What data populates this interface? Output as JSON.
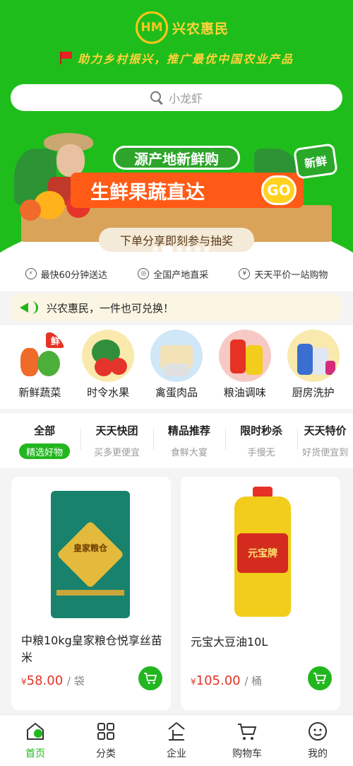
{
  "header": {
    "logo_mark": "HM",
    "logo_text": "兴农惠民",
    "slogan": "助力乡村振兴，推广最优中国农业产品"
  },
  "search": {
    "placeholder": "小龙虾"
  },
  "banner": {
    "headline": "源产地新鲜购",
    "main": "生鲜果蔬直达",
    "go": "GO",
    "sub": "下单分享即刻参与抽奖",
    "tag": "新鲜",
    "slides": 6,
    "active_slide": 2
  },
  "features": [
    {
      "icon": "lightning-icon",
      "label": "最快60分钟送达"
    },
    {
      "icon": "globe-icon",
      "label": "全国产地直采"
    },
    {
      "icon": "yen-icon",
      "label": "天天平价一站购物"
    }
  ],
  "notice": {
    "text": "兴农惠民，一件也可兑换！"
  },
  "categories": [
    {
      "label": "新鲜蔬菜",
      "badge": "鲜"
    },
    {
      "label": "时令水果"
    },
    {
      "label": "禽蛋肉品"
    },
    {
      "label": "粮油调味"
    },
    {
      "label": "厨房洗护"
    }
  ],
  "tabs": [
    {
      "title": "全部",
      "sub": "精选好物",
      "active": true
    },
    {
      "title": "天天快团",
      "sub": "买多更便宜"
    },
    {
      "title": "精品推荐",
      "sub": "食鲜大宴"
    },
    {
      "title": "限时秒杀",
      "sub": "手慢无"
    },
    {
      "title": "天天特价",
      "sub": "好货便宜到"
    }
  ],
  "products": [
    {
      "name": "中粮10kg皇家粮仓悦享丝苗米",
      "currency": "¥",
      "price": "58.00",
      "unit": "/ 袋",
      "image_text": "皇家粮仓"
    },
    {
      "name": "元宝大豆油10L",
      "currency": "¥",
      "price": "105.00",
      "unit": "/ 桶",
      "image_text": "元宝牌"
    }
  ],
  "tabbar": [
    {
      "label": "首页",
      "icon": "home-icon",
      "active": true
    },
    {
      "label": "分类",
      "icon": "grid-icon"
    },
    {
      "label": "企业",
      "icon": "enterprise-icon"
    },
    {
      "label": "购物车",
      "icon": "cart-icon"
    },
    {
      "label": "我的",
      "icon": "profile-icon"
    }
  ],
  "colors": {
    "brand_green": "#1fbd1b",
    "price_red": "#e53224",
    "logo_gold": "#ffc61c"
  }
}
